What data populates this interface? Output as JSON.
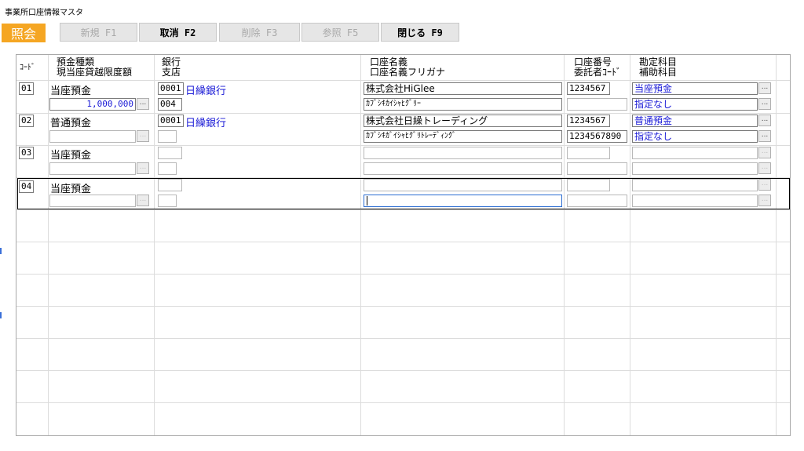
{
  "window": {
    "title": "事業所口座情報マスタ"
  },
  "mode_label": "照会",
  "toolbar": {
    "new_label": "新規 F1",
    "cancel_label": "取消 F2",
    "delete_label": "削除 F3",
    "refer_label": "参照 F5",
    "close_label": "閉じる F9"
  },
  "columns": {
    "code": "ｺｰﾄﾞ",
    "deposit": "預金種類\n現当座貸越限度額",
    "bank": "銀行\n支店",
    "account_name": "口座名義\n口座名義フリガナ",
    "account_no": "口座番号\n委託者ｺｰﾄﾞ",
    "subject": "勘定科目\n補助科目"
  },
  "rows": [
    {
      "code": "01",
      "deposit_type": "当座預金",
      "overdraft": "1,000,000",
      "bank_code": "0001",
      "bank_name": "日繰銀行",
      "branch_code": "004",
      "name": "株式会社HiGlee",
      "kana": "ｶﾌﾞｼｷｶｲｼｬﾋｸﾞﾘｰ",
      "account_no": "1234567",
      "consignor": "",
      "subject": "当座預金",
      "sub_subject": "指定なし"
    },
    {
      "code": "02",
      "deposit_type": "普通預金",
      "overdraft": "",
      "bank_code": "0001",
      "bank_name": "日繰銀行",
      "branch_code": "",
      "name": "株式会社日繰トレーディング",
      "kana": "ｶﾌﾞｼｷｶﾞｲｼｬﾋｸﾞﾘﾄﾚｰﾃﾞｨﾝｸﾞ",
      "account_no": "1234567",
      "consignor": "1234567890",
      "subject": "普通預金",
      "sub_subject": "指定なし"
    },
    {
      "code": "03",
      "deposit_type": "当座預金",
      "overdraft": "",
      "bank_code": "",
      "bank_name": "",
      "branch_code": "",
      "name": "",
      "kana": "",
      "account_no": "",
      "consignor": "",
      "subject": "",
      "sub_subject": ""
    },
    {
      "code": "04",
      "deposit_type": "当座預金",
      "overdraft": "",
      "bank_code": "",
      "bank_name": "",
      "branch_code": "",
      "name": "",
      "kana": "",
      "account_no": "",
      "consignor": "",
      "subject": "",
      "sub_subject": ""
    }
  ],
  "dots_label": "...",
  "colors": {
    "mode_bg": "#f5a623",
    "link": "#1a1ad6",
    "focus": "#2a6bd1"
  }
}
